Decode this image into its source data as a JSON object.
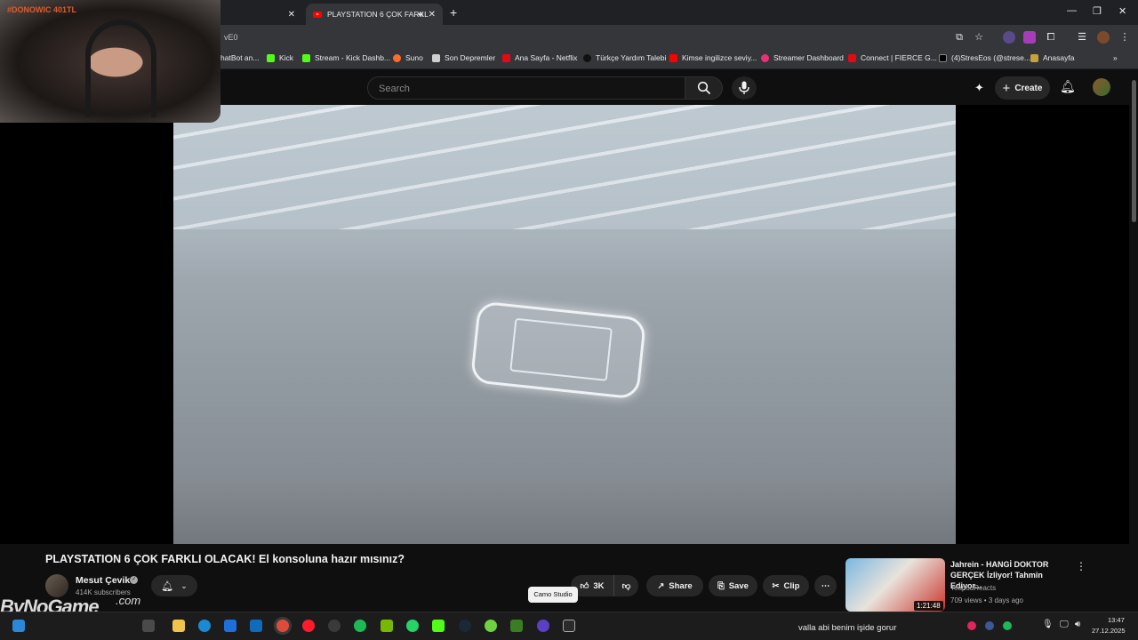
{
  "browser": {
    "tabs": [
      {
        "label": ""
      },
      {
        "label": "PLAYSTATION 6 ÇOK FARKL",
        "active": true
      }
    ],
    "address_fragment": "vE0",
    "bookmarks": [
      {
        "label": "hatBot an...",
        "color": "#5f6368"
      },
      {
        "label": "Kick",
        "color": "#53fc18"
      },
      {
        "label": "Stream - Kick Dashb...",
        "color": "#53fc18"
      },
      {
        "label": "Suno",
        "color": "#ff6b2c"
      },
      {
        "label": "Son Depremler",
        "color": "#d0d0d0"
      },
      {
        "label": "Ana Sayfa - Netflix",
        "color": "#e50914"
      },
      {
        "label": "Türkçe Yardım Talebi",
        "color": "#202124"
      },
      {
        "label": "Kimse ingilizce seviy...",
        "color": "#ff0000"
      },
      {
        "label": "Streamer Dashboard",
        "color": "#e9317a"
      },
      {
        "label": "Connect | FIERCE G...",
        "color": "#e50914"
      },
      {
        "label": "(4)StresEos (@strese...",
        "color": "#000000"
      },
      {
        "label": "Anasayfa",
        "color": "#c9a13b"
      }
    ]
  },
  "youtube": {
    "search_placeholder": "Search",
    "create_label": "Create",
    "video": {
      "title": "PLAYSTATION 6 ÇOK FARKLI OLACAK! El konsoluna hazır mısınız?",
      "channel": "Mesut Çevik",
      "subscribers": "414K subscribers",
      "likes": "3K",
      "share_label": "Share",
      "save_label": "Save",
      "clip_label": "Clip"
    },
    "tooltip": "Camo Studio",
    "recommendation": {
      "title": "Jahrein - HANGİ DOKTOR GERÇEK İzliyor! Tahmin Ediyor...",
      "channel": "TeapodReacts",
      "meta": "709 views • 3 days ago",
      "duration": "1:21:48"
    }
  },
  "overlay": {
    "webcam_label": "#DONOWIC 401TL",
    "watermark": "ByNoGame",
    "watermark_suffix": ".com"
  },
  "taskbar": {
    "tray_text": "valla abi benim işide gorur",
    "time": "13:47",
    "date": "27.12.2025"
  }
}
